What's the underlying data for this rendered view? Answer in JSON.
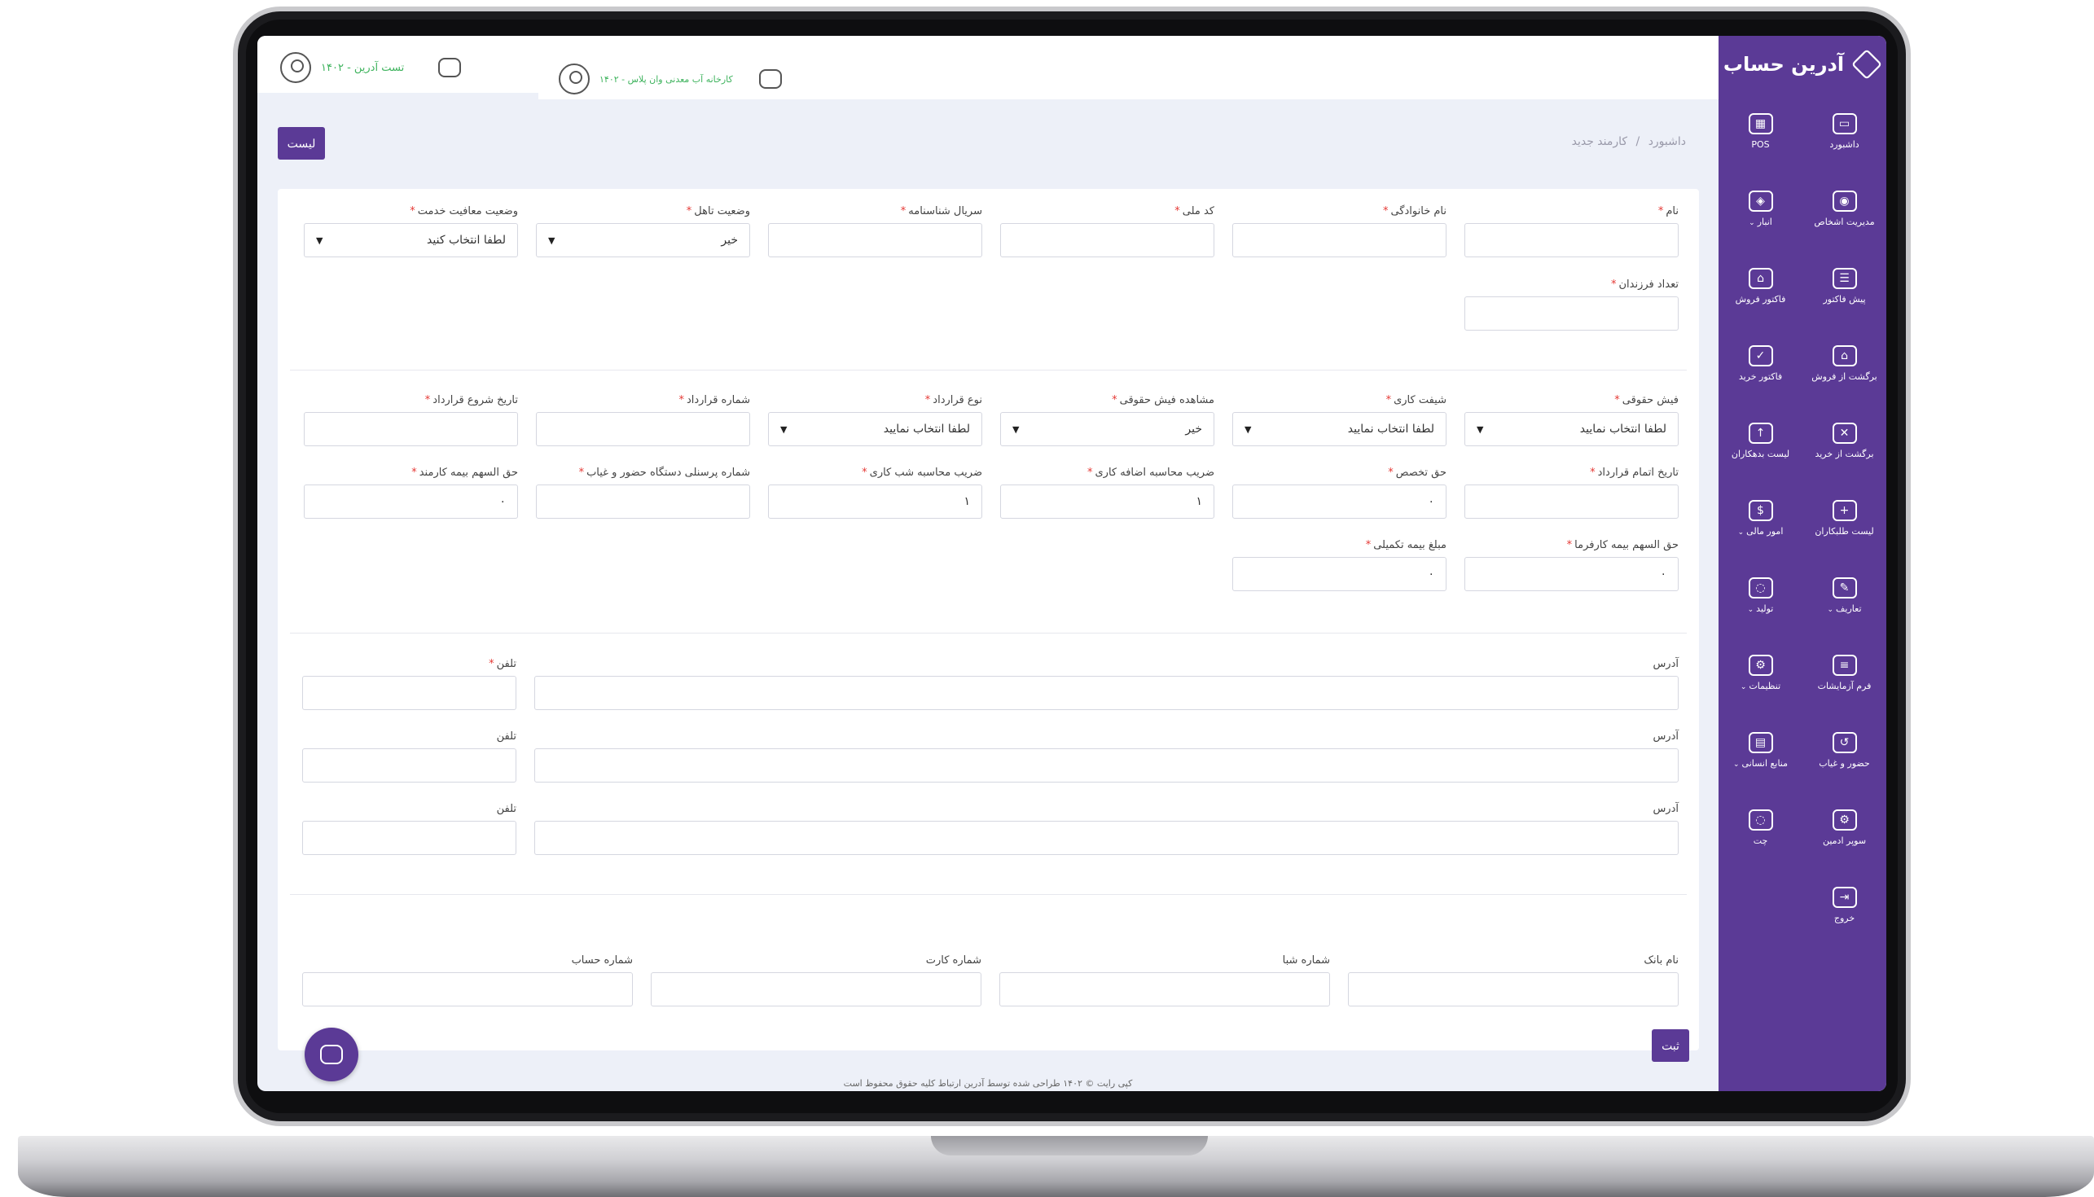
{
  "brand": {
    "name": "آدرین حساب"
  },
  "sidebar": {
    "items": [
      {
        "label": "داشبورد",
        "icon": "monitor-icon",
        "glyph": "▭",
        "dropdown": false
      },
      {
        "label": "POS",
        "icon": "pos-icon",
        "glyph": "▦",
        "dropdown": false
      },
      {
        "label": "مدیریت اشخاص",
        "icon": "shield-user-icon",
        "glyph": "◉",
        "dropdown": false
      },
      {
        "label": "انبار",
        "icon": "box-icon",
        "glyph": "◈",
        "dropdown": true
      },
      {
        "label": "پیش فاکتور",
        "icon": "checklist-icon",
        "glyph": "☰",
        "dropdown": false
      },
      {
        "label": "فاکتور فروش",
        "icon": "basket-icon",
        "glyph": "⌂",
        "dropdown": false
      },
      {
        "label": "برگشت از فروش",
        "icon": "basket-return-icon",
        "glyph": "⌂",
        "dropdown": false
      },
      {
        "label": "فاکتور خرید",
        "icon": "cart-check-icon",
        "glyph": "✓",
        "dropdown": false
      },
      {
        "label": "برگشت از خرید",
        "icon": "cart-x-icon",
        "glyph": "✕",
        "dropdown": false
      },
      {
        "label": "لیست بدهکاران",
        "icon": "user-up-icon",
        "glyph": "↑",
        "dropdown": false
      },
      {
        "label": "لیست طلبکاران",
        "icon": "user-add-icon",
        "glyph": "+",
        "dropdown": false
      },
      {
        "label": "امور مالی",
        "icon": "dollar-icon",
        "glyph": "$",
        "dropdown": true
      },
      {
        "label": "تعاریف",
        "icon": "edit-icon",
        "glyph": "✎",
        "dropdown": true
      },
      {
        "label": "تولید",
        "icon": "chat-bubble-icon",
        "glyph": "◌",
        "dropdown": true
      },
      {
        "label": "فرم آزمایشات",
        "icon": "clipboard-icon",
        "glyph": "≡",
        "dropdown": false
      },
      {
        "label": "تنظیمات",
        "icon": "gear-icon",
        "glyph": "⚙",
        "dropdown": true
      },
      {
        "label": "حضور و غیاب",
        "icon": "history-icon",
        "glyph": "↺",
        "dropdown": false
      },
      {
        "label": "منابع انسانی",
        "icon": "id-card-icon",
        "glyph": "▤",
        "dropdown": true
      },
      {
        "label": "سوپر ادمین",
        "icon": "user-gear-icon",
        "glyph": "⚙",
        "dropdown": false
      },
      {
        "label": "چت",
        "icon": "chat-icon",
        "glyph": "◌",
        "dropdown": false
      },
      {
        "label": "خروج",
        "icon": "logout-icon",
        "glyph": "⇥",
        "dropdown": false
      }
    ]
  },
  "topbar": {
    "user1": "تست آدرین - ۱۴۰۲",
    "user2": "کارخانه آب معدنی وان پلاس - ۱۴۰۲"
  },
  "breadcrumb": {
    "home": "داشبورد",
    "separator": "/",
    "current": "کارمند جدید"
  },
  "buttons": {
    "list": "لیست",
    "submit": "ثبت"
  },
  "form": {
    "row1": [
      {
        "label": "نام",
        "required": true,
        "value": "",
        "type": "input"
      },
      {
        "label": "نام خانوادگی",
        "required": true,
        "value": "",
        "type": "input"
      },
      {
        "label": "کد ملی",
        "required": true,
        "value": "",
        "type": "input"
      },
      {
        "label": "سریال شناسنامه",
        "required": true,
        "value": "",
        "type": "input"
      },
      {
        "label": "وضعیت تاهل",
        "required": true,
        "value": "خیر",
        "type": "select"
      },
      {
        "label": "وضعیت معافیت خدمت",
        "required": true,
        "value": "لطفا انتخاب کنید",
        "type": "select"
      }
    ],
    "row2": [
      {
        "label": "تعداد فرزندان",
        "required": true,
        "value": "",
        "type": "input"
      }
    ],
    "row3": [
      {
        "label": "فیش حقوقی",
        "required": true,
        "value": "لطفا انتخاب نمایید",
        "type": "select"
      },
      {
        "label": "شیفت کاری",
        "required": true,
        "value": "لطفا انتخاب نمایید",
        "type": "select"
      },
      {
        "label": "مشاهده فیش حقوقی",
        "required": true,
        "value": "خیر",
        "type": "select"
      },
      {
        "label": "نوع قرارداد",
        "required": true,
        "value": "لطفا انتخاب نمایید",
        "type": "select"
      },
      {
        "label": "شماره قرارداد",
        "required": true,
        "value": "",
        "type": "input"
      },
      {
        "label": "تاریخ شروع قرارداد",
        "required": true,
        "value": "",
        "type": "input"
      }
    ],
    "row4": [
      {
        "label": "تاریخ اتمام قرارداد",
        "required": true,
        "value": "",
        "type": "input"
      },
      {
        "label": "حق تخصص",
        "required": true,
        "value": "۰",
        "type": "input"
      },
      {
        "label": "ضریب محاسبه اضافه کاری",
        "required": true,
        "value": "۱",
        "type": "input"
      },
      {
        "label": "ضریب محاسبه شب کاری",
        "required": true,
        "value": "۱",
        "type": "input"
      },
      {
        "label": "شماره پرسنلی دستگاه حضور و غیاب",
        "required": true,
        "value": "",
        "type": "input"
      },
      {
        "label": "حق السهم بیمه کارمند",
        "required": true,
        "value": "۰",
        "type": "input"
      }
    ],
    "row5": [
      {
        "label": "حق السهم بیمه کارفرما",
        "required": true,
        "value": "۰",
        "type": "input"
      },
      {
        "label": "مبلغ بیمه تکمیلی",
        "required": true,
        "value": "۰",
        "type": "input"
      }
    ],
    "addresses": [
      {
        "address_label": "آدرس",
        "phone_label": "تلفن",
        "phone_required": true
      },
      {
        "address_label": "آدرس",
        "phone_label": "تلفن",
        "phone_required": false
      },
      {
        "address_label": "آدرس",
        "phone_label": "تلفن",
        "phone_required": false
      }
    ],
    "bank": [
      {
        "label": "نام بانک"
      },
      {
        "label": "شماره شبا"
      },
      {
        "label": "شماره کارت"
      },
      {
        "label": "شماره حساب"
      }
    ]
  },
  "footer": "کپی رایت © ۱۴۰۲ طراحی شده توسط آدرین ارتباط کلیه حقوق محفوظ است",
  "colors": {
    "primary": "#5b3a96",
    "required": "#e53935",
    "user_name": "#3eb35d"
  }
}
